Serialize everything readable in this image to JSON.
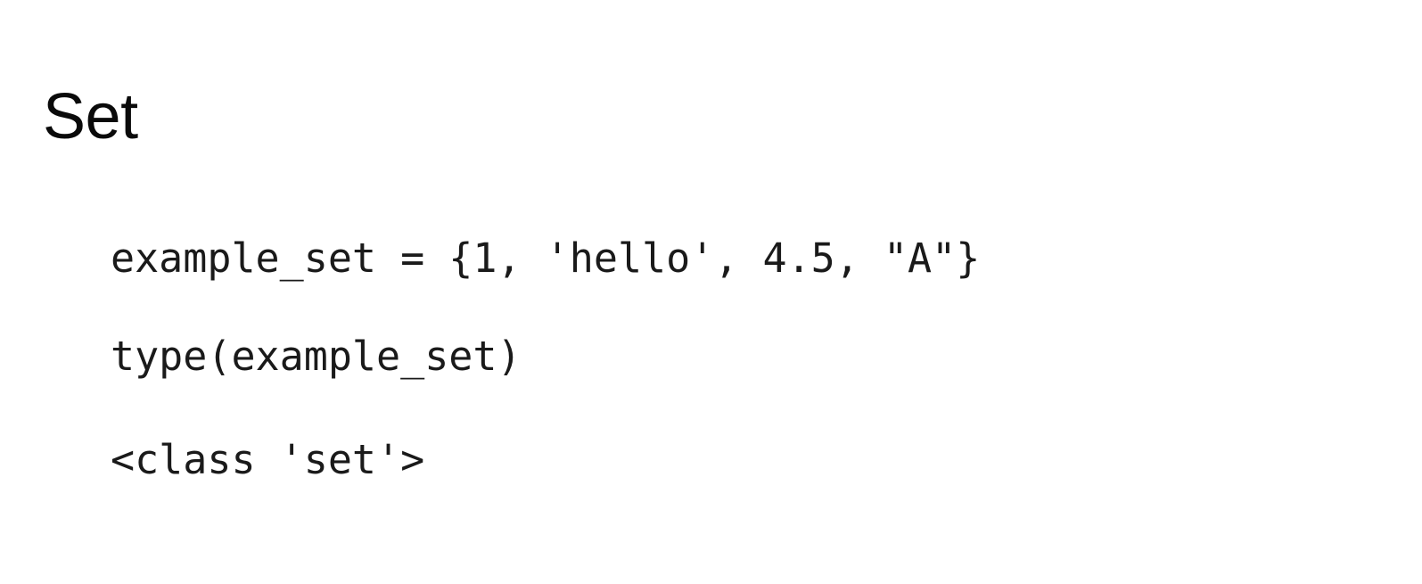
{
  "slide": {
    "title": "Set",
    "code_lines": [
      "example_set = {1, 'hello', 4.5, \"A\"}",
      "type(example_set)",
      "<class 'set'>"
    ]
  }
}
